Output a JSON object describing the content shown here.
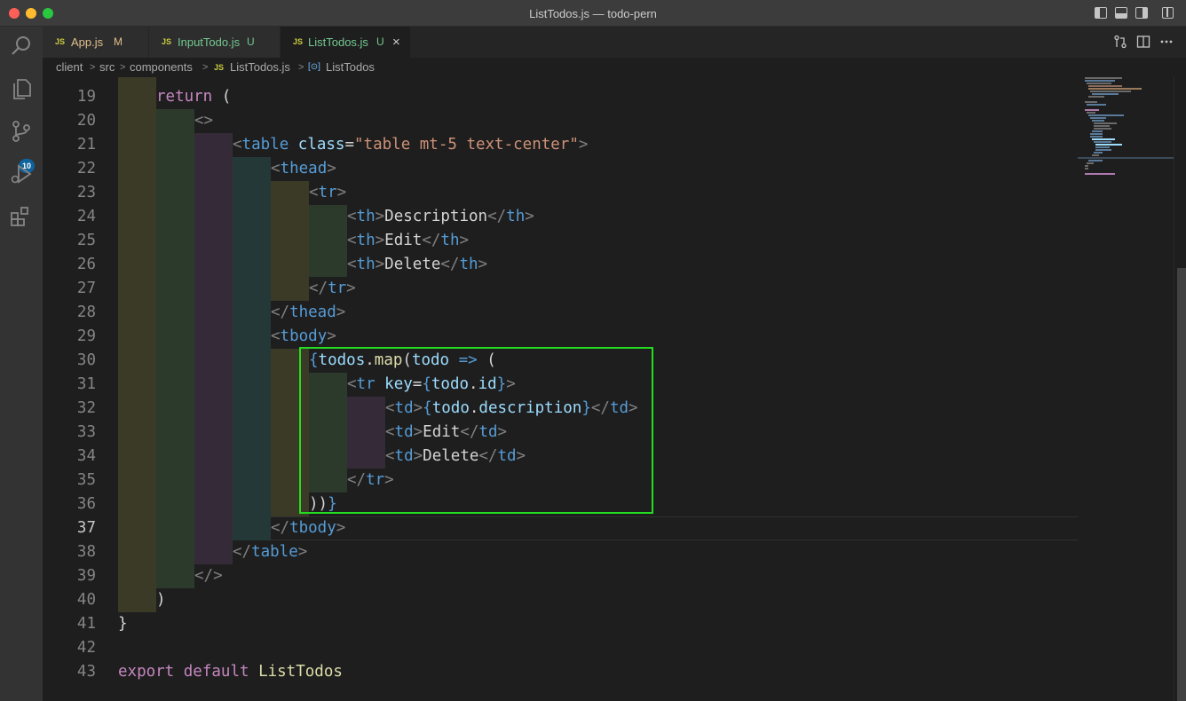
{
  "window": {
    "title": "ListTodos.js — todo-pern"
  },
  "activity_bar": {
    "source_control_badge": "10"
  },
  "tabs": [
    {
      "icon": "JS",
      "label": "App.js",
      "status": "M"
    },
    {
      "icon": "JS",
      "label": "InputTodo.js",
      "status": "U"
    },
    {
      "icon": "JS",
      "label": "ListTodos.js",
      "status": "U",
      "close": "×"
    }
  ],
  "breadcrumb": {
    "items": [
      "client",
      "src",
      "components",
      "ListTodos.js",
      "ListTodos"
    ],
    "file_icon": "JS",
    "symbol_icon": "[⊙]"
  },
  "editor": {
    "partial_top_line": "18",
    "current_line": "37",
    "lines": [
      {
        "n": "19",
        "tokens": [
          [
            "kw",
            "return"
          ],
          [
            "plain",
            " ("
          ]
        ]
      },
      {
        "n": "20",
        "tokens": [
          [
            "br",
            "<>"
          ]
        ]
      },
      {
        "n": "21",
        "tokens": [
          [
            "br",
            "<"
          ],
          [
            "tag",
            "table"
          ],
          [
            "plain",
            " "
          ],
          [
            "attr",
            "class"
          ],
          [
            "plain",
            "="
          ],
          [
            "str",
            "\"table mt-5 text-center\""
          ],
          [
            "br",
            ">"
          ]
        ]
      },
      {
        "n": "22",
        "tokens": [
          [
            "br",
            "<"
          ],
          [
            "tag",
            "thead"
          ],
          [
            "br",
            ">"
          ]
        ]
      },
      {
        "n": "23",
        "tokens": [
          [
            "br",
            "<"
          ],
          [
            "tag",
            "tr"
          ],
          [
            "br",
            ">"
          ]
        ]
      },
      {
        "n": "24",
        "tokens": [
          [
            "br",
            "<"
          ],
          [
            "tag",
            "th"
          ],
          [
            "br",
            ">"
          ],
          [
            "plain",
            "Description"
          ],
          [
            "br",
            "</"
          ],
          [
            "tag",
            "th"
          ],
          [
            "br",
            ">"
          ]
        ]
      },
      {
        "n": "25",
        "tokens": [
          [
            "br",
            "<"
          ],
          [
            "tag",
            "th"
          ],
          [
            "br",
            ">"
          ],
          [
            "plain",
            "Edit"
          ],
          [
            "br",
            "</"
          ],
          [
            "tag",
            "th"
          ],
          [
            "br",
            ">"
          ]
        ]
      },
      {
        "n": "26",
        "tokens": [
          [
            "br",
            "<"
          ],
          [
            "tag",
            "th"
          ],
          [
            "br",
            ">"
          ],
          [
            "plain",
            "Delete"
          ],
          [
            "br",
            "</"
          ],
          [
            "tag",
            "th"
          ],
          [
            "br",
            ">"
          ]
        ]
      },
      {
        "n": "27",
        "tokens": [
          [
            "br",
            "</"
          ],
          [
            "tag",
            "tr"
          ],
          [
            "br",
            ">"
          ]
        ]
      },
      {
        "n": "28",
        "tokens": [
          [
            "br",
            "</"
          ],
          [
            "tag",
            "thead"
          ],
          [
            "br",
            ">"
          ]
        ]
      },
      {
        "n": "29",
        "tokens": [
          [
            "br",
            "<"
          ],
          [
            "tag",
            "tbody"
          ],
          [
            "br",
            ">"
          ]
        ]
      },
      {
        "n": "30",
        "tokens": [
          [
            "tag",
            "{"
          ],
          [
            "var",
            "todos"
          ],
          [
            "plain",
            "."
          ],
          [
            "fn",
            "map"
          ],
          [
            "plain",
            "("
          ],
          [
            "var",
            "todo"
          ],
          [
            "plain",
            " "
          ],
          [
            "tag",
            "=>"
          ],
          [
            "plain",
            " ("
          ]
        ]
      },
      {
        "n": "31",
        "tokens": [
          [
            "br",
            "<"
          ],
          [
            "tag",
            "tr"
          ],
          [
            "plain",
            " "
          ],
          [
            "attr",
            "key"
          ],
          [
            "plain",
            "="
          ],
          [
            "tag",
            "{"
          ],
          [
            "var",
            "todo"
          ],
          [
            "plain",
            "."
          ],
          [
            "var",
            "id"
          ],
          [
            "tag",
            "}"
          ],
          [
            "br",
            ">"
          ]
        ]
      },
      {
        "n": "32",
        "tokens": [
          [
            "br",
            "<"
          ],
          [
            "tag",
            "td"
          ],
          [
            "br",
            ">"
          ],
          [
            "tag",
            "{"
          ],
          [
            "var",
            "todo"
          ],
          [
            "plain",
            "."
          ],
          [
            "var",
            "description"
          ],
          [
            "tag",
            "}"
          ],
          [
            "br",
            "</"
          ],
          [
            "tag",
            "td"
          ],
          [
            "br",
            ">"
          ]
        ]
      },
      {
        "n": "33",
        "tokens": [
          [
            "br",
            "<"
          ],
          [
            "tag",
            "td"
          ],
          [
            "br",
            ">"
          ],
          [
            "plain",
            "Edit"
          ],
          [
            "br",
            "</"
          ],
          [
            "tag",
            "td"
          ],
          [
            "br",
            ">"
          ]
        ]
      },
      {
        "n": "34",
        "tokens": [
          [
            "br",
            "<"
          ],
          [
            "tag",
            "td"
          ],
          [
            "br",
            ">"
          ],
          [
            "plain",
            "Delete"
          ],
          [
            "br",
            "</"
          ],
          [
            "tag",
            "td"
          ],
          [
            "br",
            ">"
          ]
        ]
      },
      {
        "n": "35",
        "tokens": [
          [
            "br",
            "</"
          ],
          [
            "tag",
            "tr"
          ],
          [
            "br",
            ">"
          ]
        ]
      },
      {
        "n": "36",
        "tokens": [
          [
            "plain",
            "))"
          ],
          [
            "tag",
            "}"
          ]
        ]
      },
      {
        "n": "37",
        "tokens": [
          [
            "br",
            "</"
          ],
          [
            "tag",
            "tbody"
          ],
          [
            "br",
            ">"
          ]
        ]
      },
      {
        "n": "38",
        "tokens": [
          [
            "br",
            "</"
          ],
          [
            "tag",
            "table"
          ],
          [
            "br",
            ">"
          ]
        ]
      },
      {
        "n": "39",
        "tokens": [
          [
            "br",
            "</>"
          ]
        ]
      },
      {
        "n": "40",
        "tokens": [
          [
            "plain",
            ")"
          ]
        ]
      },
      {
        "n": "41",
        "tokens": [
          [
            "plain",
            "}"
          ]
        ]
      },
      {
        "n": "42",
        "tokens": []
      },
      {
        "n": "43",
        "tokens": [
          [
            "kw",
            "export"
          ],
          [
            "plain",
            " "
          ],
          [
            "kw",
            "default"
          ],
          [
            "plain",
            " "
          ],
          [
            "fn",
            "ListTodos"
          ]
        ]
      }
    ]
  },
  "colors": {
    "highlight_box": "#22dd22",
    "guide_olive": "#3a3a26",
    "guide_green": "#2b3a2b",
    "guide_purple": "#352b38",
    "guide_teal": "#253838"
  }
}
